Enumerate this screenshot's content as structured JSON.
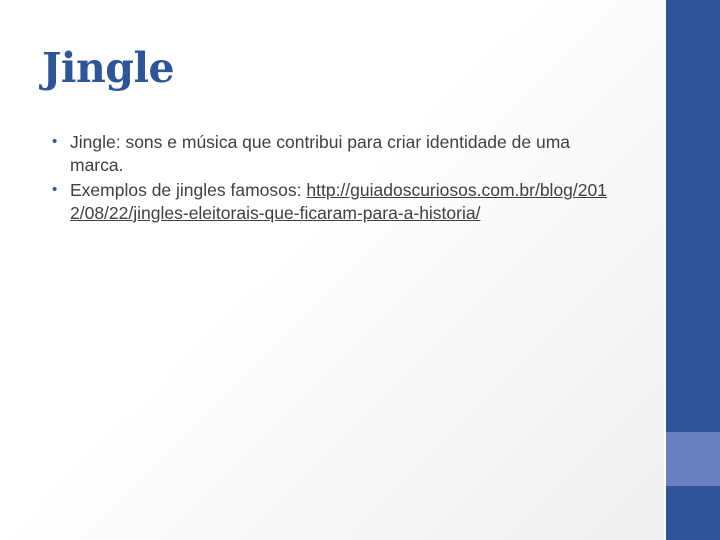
{
  "slide": {
    "title": "Jingle",
    "bullets": [
      {
        "text": "Jingle: sons e música que contribui para criar identidade de uma marca."
      },
      {
        "text": "Exemplos de jingles famosos: ",
        "link": "http://guiadoscuriosos.com.br/blog/2012/08/22/jingles-eleitorais-que-ficaram-para-a-historia/"
      }
    ],
    "bullet_marker": "•"
  },
  "colors": {
    "accent": "#2d5597",
    "accent_light": "#6a80c0",
    "body_text": "#404040"
  }
}
